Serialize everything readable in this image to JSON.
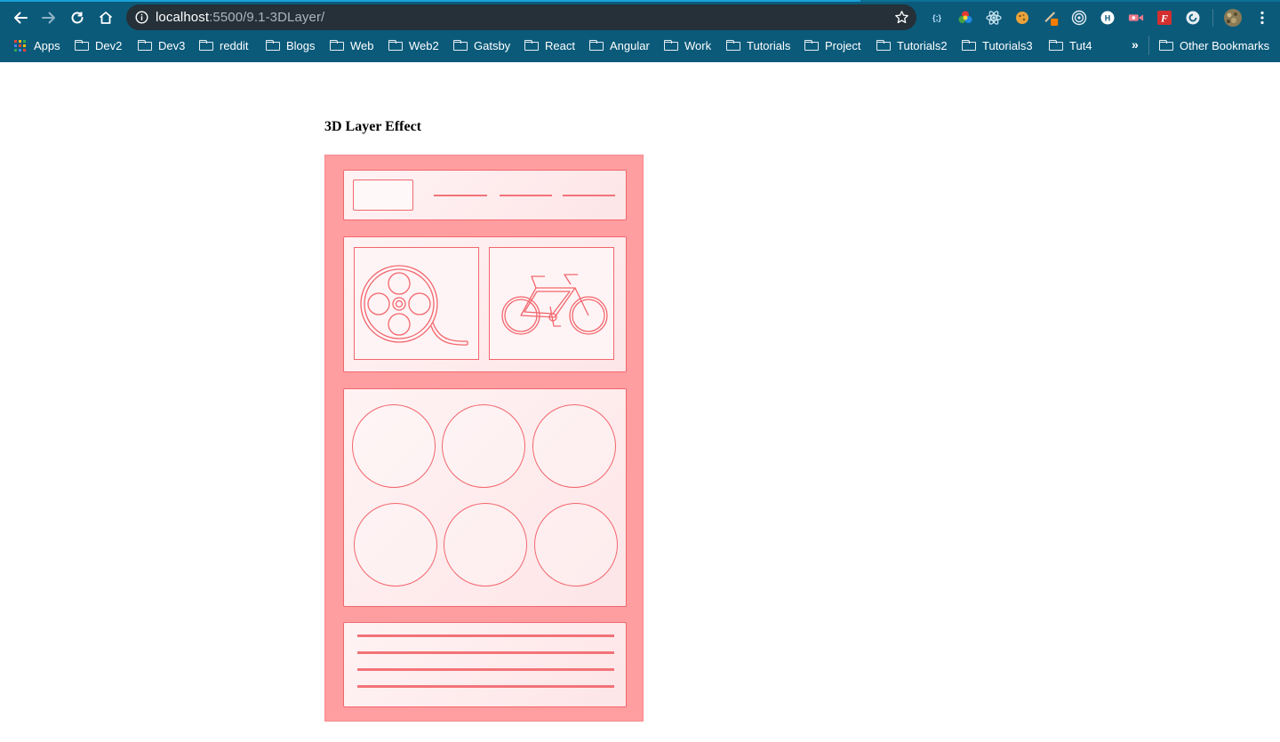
{
  "browser": {
    "url_host": "localhost",
    "url_path": ":5500/9.1-3DLayer/",
    "bookmarks": {
      "apps_label": "Apps",
      "folders": [
        "Dev2",
        "Dev3",
        "reddit",
        "Blogs",
        "Web",
        "Web2",
        "Gatsby",
        "React",
        "Angular",
        "Work",
        "Tutorials",
        "Project",
        "Tutorials2",
        "Tutorials3",
        "Tut4"
      ],
      "overflow": "»",
      "other": "Other Bookmarks"
    },
    "extensions": [
      "json-formatter-icon",
      "color-picker-icon",
      "react-devtools-icon",
      "cookie-icon",
      "pen-icon",
      "target-icon",
      "hash-icon",
      "video-icon",
      "font-icon",
      "refresh-circle-icon"
    ],
    "colors": {
      "chrome": "#0b5a7a",
      "omnibox": "#253038"
    }
  },
  "page": {
    "title": "3D Layer Effect",
    "colors": {
      "layer_bg": "#ff9ea1",
      "stroke": "#f2666d",
      "panel_bg": "#fff3f4"
    },
    "media_icons": [
      "film-reel-icon",
      "bicycle-icon"
    ]
  }
}
